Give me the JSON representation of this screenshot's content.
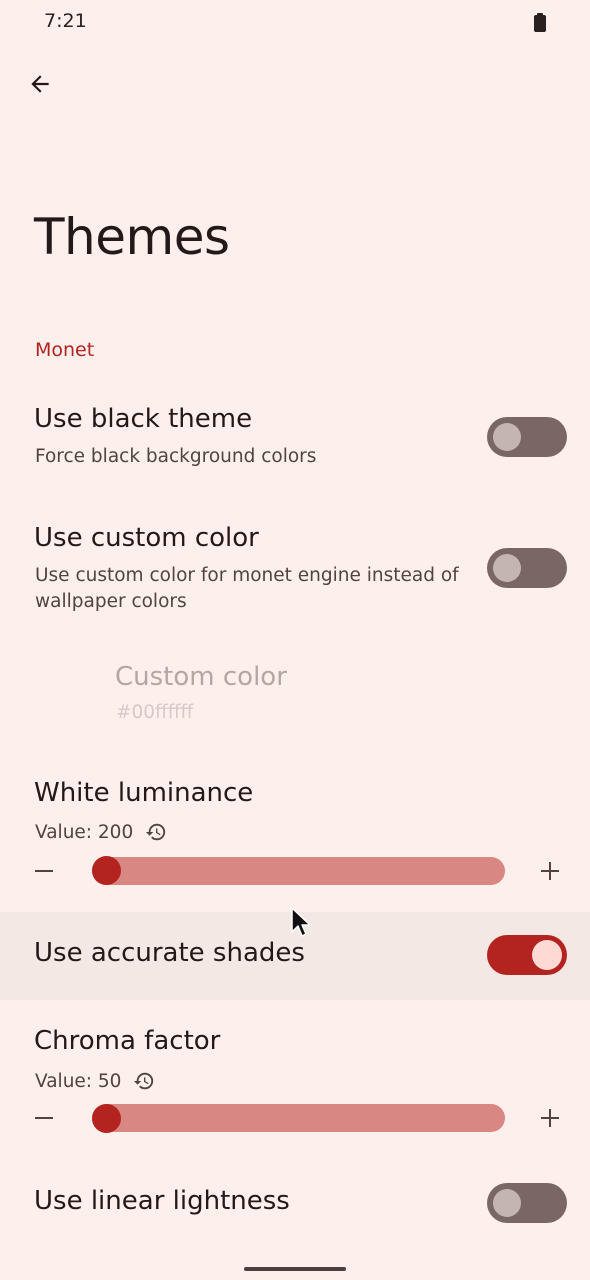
{
  "status_bar": {
    "time": "7:21"
  },
  "page": {
    "title": "Themes"
  },
  "section": {
    "header": "Monet"
  },
  "settings": {
    "black_theme": {
      "title": "Use black theme",
      "summary": "Force black background colors",
      "enabled": false
    },
    "custom_color_toggle": {
      "title": "Use custom color",
      "summary_line1": "Use custom color for monet engine instead of",
      "summary_line2": "wallpaper colors",
      "enabled": false
    },
    "custom_color": {
      "title": "Custom color",
      "summary": "#00ffffff"
    },
    "white_luminance": {
      "title": "White luminance",
      "value_text": "Value: 200",
      "value": 200
    },
    "accurate_shades": {
      "title": "Use accurate shades",
      "enabled": true
    },
    "chroma_factor": {
      "title": "Chroma factor",
      "value_text": "Value: 50",
      "value": 50
    },
    "linear_lightness": {
      "title": "Use linear lightness",
      "enabled": false
    }
  },
  "colors": {
    "accent": "#b3231f",
    "track": "#d98782",
    "background": "#fcefec"
  }
}
